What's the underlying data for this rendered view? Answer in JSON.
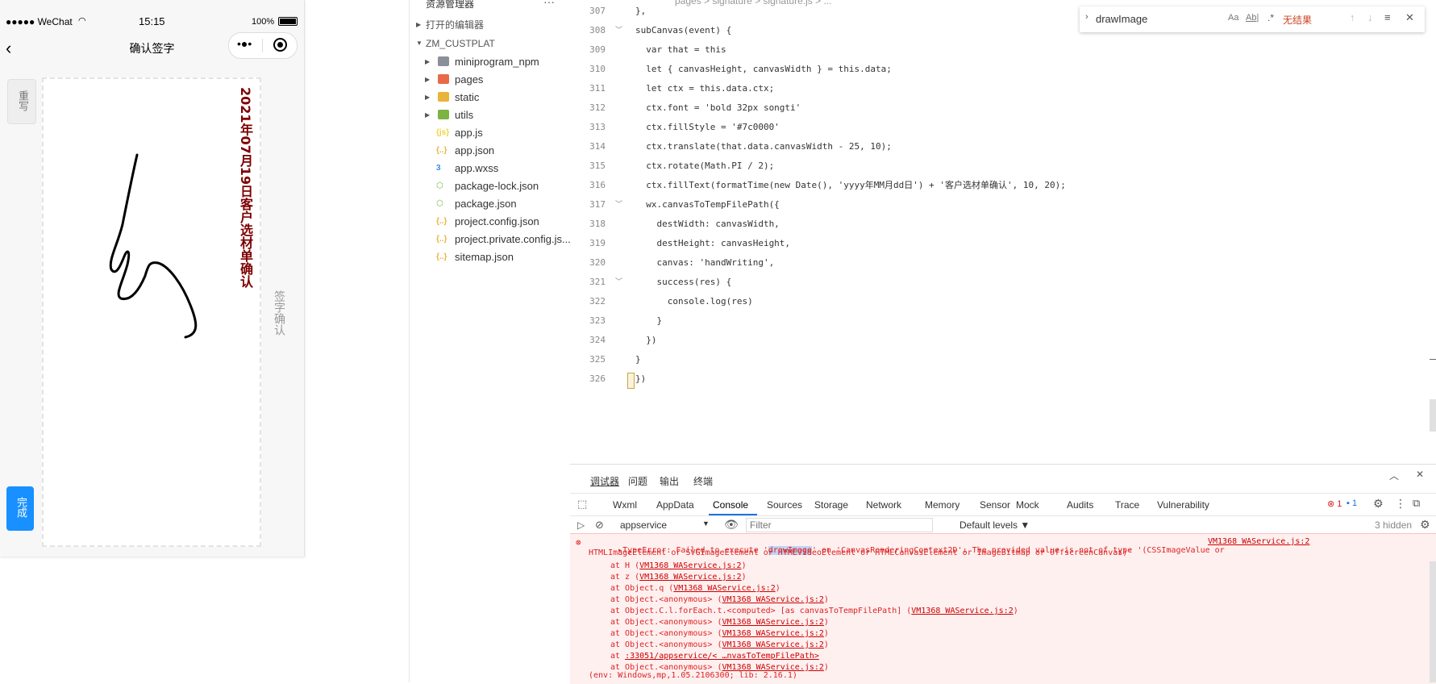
{
  "simulator": {
    "status": {
      "carrier": "●●●●● WeChat",
      "wifi": "wifi-icon",
      "time": "15:15",
      "battery": "100%"
    },
    "nav_title": "确认签字",
    "rewrite_label": "重写",
    "canvas_title_text": "2021年07月19日客户选材单确认",
    "confirm_label": "签字确认",
    "done_label": "完成"
  },
  "explorer": {
    "header": "资源管理器",
    "more": "···",
    "open_editors": "打开的编辑器",
    "root": "ZM_CUSTPLAT",
    "items": [
      {
        "label": "miniprogram_npm",
        "type": "folder",
        "icon_color": "#8a8f9a"
      },
      {
        "label": "pages",
        "type": "folder",
        "icon_color": "#e86a4a"
      },
      {
        "label": "static",
        "type": "folder",
        "icon_color": "#e8b43a"
      },
      {
        "label": "utils",
        "type": "folder",
        "icon_color": "#7cb342"
      },
      {
        "label": "app.js",
        "type": "file",
        "icon": "{js}",
        "icon_color": "#f0d43a"
      },
      {
        "label": "app.json",
        "type": "file",
        "icon": "{..}",
        "icon_color": "#e8b43a"
      },
      {
        "label": "app.wxss",
        "type": "file",
        "icon": "3",
        "icon_color": "#3a8ee8"
      },
      {
        "label": "package-lock.json",
        "type": "file",
        "icon": "⬡",
        "icon_color": "#7cb342"
      },
      {
        "label": "package.json",
        "type": "file",
        "icon": "⬡",
        "icon_color": "#7cb342"
      },
      {
        "label": "project.config.json",
        "type": "file",
        "icon": "{..}",
        "icon_color": "#e8b43a"
      },
      {
        "label": "project.private.config.js...",
        "type": "file",
        "icon": "{..}",
        "icon_color": "#e8b43a"
      },
      {
        "label": "sitemap.json",
        "type": "file",
        "icon": "{..}",
        "icon_color": "#e8b43a"
      }
    ]
  },
  "editor": {
    "breadcrumb": "pages > signature > signature.js > ...",
    "lines": [
      {
        "no": "307",
        "code": "},"
      },
      {
        "no": "308",
        "code": "subCanvas(event) {"
      },
      {
        "no": "309",
        "code": "  var that = this"
      },
      {
        "no": "310",
        "code": "  let { canvasHeight, canvasWidth } = this.data;"
      },
      {
        "no": "311",
        "code": "  let ctx = this.data.ctx;"
      },
      {
        "no": "312",
        "code": "  ctx.font = 'bold 32px songti'"
      },
      {
        "no": "313",
        "code": "  ctx.fillStyle = '#7c0000'"
      },
      {
        "no": "314",
        "code": "  ctx.translate(that.data.canvasWidth - 25, 10);"
      },
      {
        "no": "315",
        "code": "  ctx.rotate(Math.PI / 2);"
      },
      {
        "no": "316",
        "code": "  ctx.fillText(formatTime(new Date(), 'yyyy年MM月dd日') + '客户选材单确认', 10, 20);"
      },
      {
        "no": "317",
        "code": "  wx.canvasToTempFilePath({"
      },
      {
        "no": "318",
        "code": "    destWidth: canvasWidth,"
      },
      {
        "no": "319",
        "code": "    destHeight: canvasHeight,"
      },
      {
        "no": "320",
        "code": "    canvas: 'handWriting',"
      },
      {
        "no": "321",
        "code": "    success(res) {"
      },
      {
        "no": "322",
        "code": "      console.log(res)"
      },
      {
        "no": "323",
        "code": "    }"
      },
      {
        "no": "324",
        "code": "  })"
      },
      {
        "no": "325",
        "code": "}"
      },
      {
        "no": "326",
        "code": "})"
      }
    ],
    "find": {
      "value": "drawImage",
      "aa": "Aa",
      "ab": "Ab|",
      "regex": ".*",
      "result": "无结果"
    }
  },
  "devtools": {
    "top_tabs": [
      "调试器",
      "问题",
      "输出",
      "终端"
    ],
    "panel_tabs": [
      "Wxml",
      "AppData",
      "Console",
      "Sources",
      "Storage",
      "Network",
      "Memory",
      "Sensor",
      "Mock",
      "Audits",
      "Trace",
      "Vulnerability"
    ],
    "active_panel": "Console",
    "error_count": "1",
    "info_count": "1",
    "context": "appservice",
    "filter_placeholder": "Filter",
    "levels": "Default levels ▼",
    "hidden": "3 hidden",
    "error": {
      "line1a": "▸TypeError: Failed to execute '",
      "highlight": "drawImage",
      "line1b": "' on 'CanvasRenderingContext2D': The provided value is not of type '(CSSImageValue or",
      "line2": "HTMLImageElement or SVGImageElement or HTMLVideoElement or HTMLCanvasElement or ImageBitmap or OffscreenCanvas)'",
      "source": "VM1368 WAService.js:2",
      "stack": [
        {
          "pre": "at H (",
          "link": "VM1368 WAService.js:2",
          "post": ")"
        },
        {
          "pre": "at z (",
          "link": "VM1368 WAService.js:2",
          "post": ")"
        },
        {
          "pre": "at Object.q (",
          "link": "VM1368 WAService.js:2",
          "post": ")"
        },
        {
          "pre": "at Object.<anonymous> (",
          "link": "VM1368 WAService.js:2",
          "post": ")"
        },
        {
          "pre": "at Object.C.l.forEach.t.<computed> [as canvasToTempFilePath] (",
          "link": "VM1368 WAService.js:2",
          "post": ")"
        },
        {
          "pre": "at Object.<anonymous> (",
          "link": "VM1368 WAService.js:2",
          "post": ")"
        },
        {
          "pre": "at Object.<anonymous> (",
          "link": "VM1368 WAService.js:2",
          "post": ")"
        },
        {
          "pre": "at Object.<anonymous> (",
          "link": "VM1368 WAService.js:2",
          "post": ")"
        },
        {
          "pre": "at ",
          "link": ":33051/appservice/< …nvasToTempFilePath>",
          "post": ""
        },
        {
          "pre": "at Object.<anonymous> (",
          "link": "VM1368 WAService.js:2",
          "post": ")"
        }
      ],
      "env": "(env: Windows,mp,1.05.2106300; lib: 2.16.1)"
    }
  }
}
